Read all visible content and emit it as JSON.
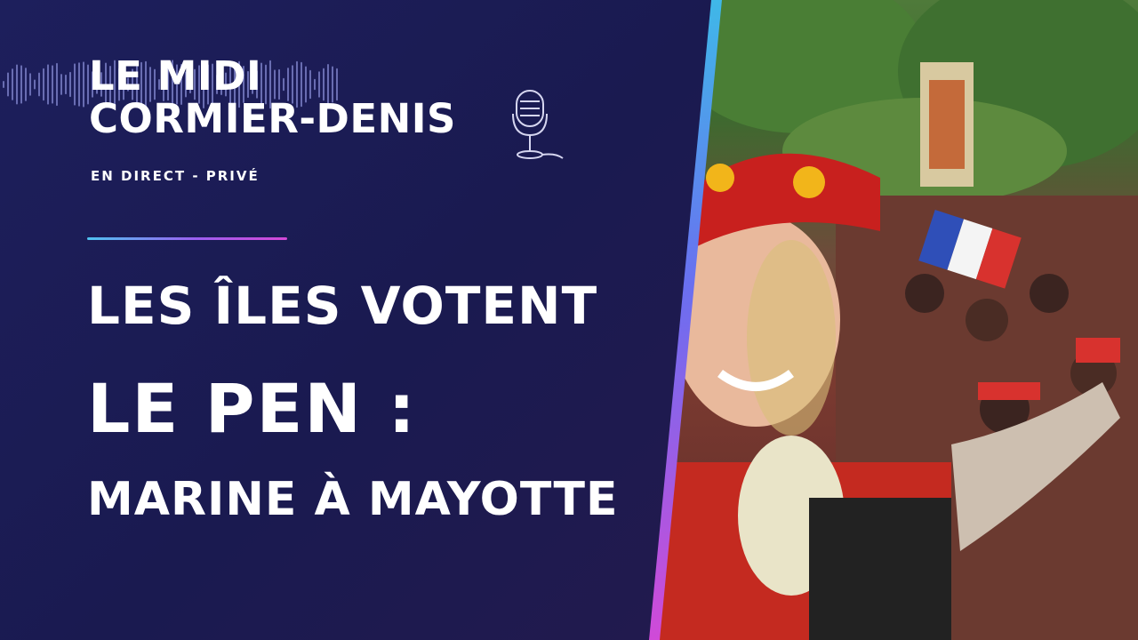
{
  "brand": {
    "line1": "LE MIDI",
    "line2": "CORMIER-DENIS",
    "tagline": "EN DIRECT - PRIVÉ"
  },
  "headline": {
    "line1": "LES ÎLES VOTENT",
    "line2": "LE PEN :",
    "line3": "MARINE À MAYOTTE"
  },
  "icons": {
    "waveform": "waveform-icon",
    "microphone": "microphone-icon"
  },
  "colors": {
    "background": "#1b1b52",
    "accent_cyan": "#4fc3f0",
    "accent_magenta": "#d448d6",
    "text": "#ffffff"
  }
}
